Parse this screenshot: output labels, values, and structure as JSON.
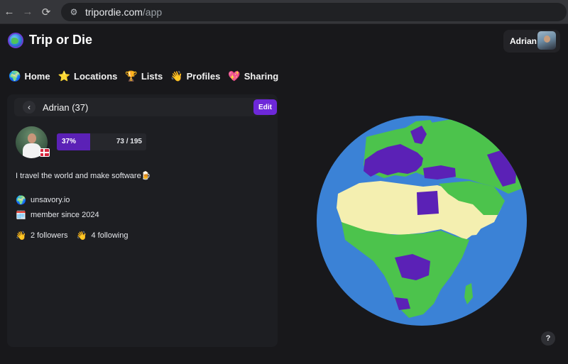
{
  "browser": {
    "back": "←",
    "forward": "→",
    "reload": "⟳",
    "url_host": "tripordie.com",
    "url_path": "/app"
  },
  "app": {
    "title": "Trip or Die",
    "user_name": "Adrian"
  },
  "nav": {
    "items": [
      {
        "emoji": "🌍",
        "label": "Home"
      },
      {
        "emoji": "⭐",
        "label": "Locations"
      },
      {
        "emoji": "🏆",
        "label": "Lists"
      },
      {
        "emoji": "👋",
        "label": "Profiles"
      },
      {
        "emoji": "💖",
        "label": "Sharing"
      }
    ]
  },
  "profile": {
    "back_label": "‹",
    "header_name": "Adrian (37)",
    "edit_label": "Edit",
    "progress_percent_label": "37%",
    "progress_fraction": 0.37,
    "progress_count": "73 / 195",
    "bio": "I travel the world and make software🍺",
    "website_icon": "🌍",
    "website": "unsavory.io",
    "member_icon": "🗓️",
    "member_since": "member since 2024",
    "followers_icon": "👋",
    "followers": "2 followers",
    "following_icon": "👋",
    "following": "4 following"
  },
  "map": {
    "ocean_color": "#3b82d6",
    "visited_color": "#5b21b6",
    "wishlist_color": "#4cc34c",
    "unvisited_color": "#f4efb0"
  },
  "help_label": "?"
}
